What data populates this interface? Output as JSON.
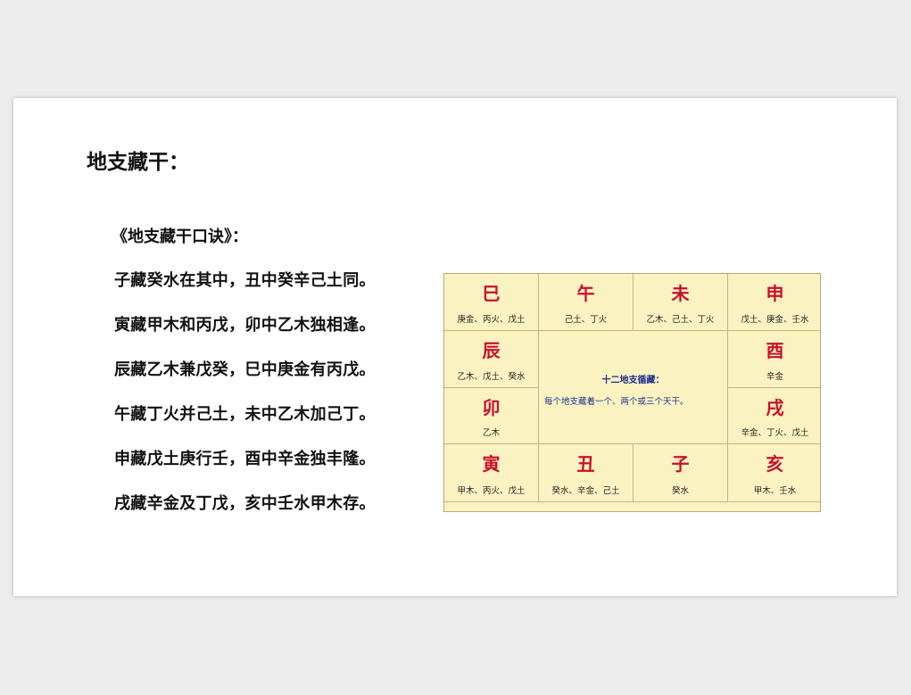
{
  "slide": {
    "heading": "地支藏干：",
    "poem_title": "《地支藏干口诀》：",
    "poem_lines": [
      "子藏癸水在其中，丑中癸辛己土同。",
      "寅藏甲木和丙戊，卯中乙木独相逢。",
      "辰藏乙木兼戊癸，巳中庚金有丙戊。",
      "午藏丁火并己土，未中乙木加己丁。",
      "申藏戊土庚行壬，酉中辛金独丰隆。",
      "戌藏辛金及丁戊，亥中壬水甲木存。"
    ]
  },
  "chart": {
    "center_title": "十二地支循藏：",
    "center_desc": "每个地支藏着一个、两个或三个天干。",
    "cells": [
      {
        "branch": "巳",
        "stems": "庚金、丙火、戊土"
      },
      {
        "branch": "午",
        "stems": "己土、丁火"
      },
      {
        "branch": "未",
        "stems": "乙木、己土、丁火"
      },
      {
        "branch": "申",
        "stems": "戊土、庚金、壬水"
      },
      {
        "branch": "辰",
        "stems": "乙木、戊土、癸水"
      },
      {
        "branch": "酉",
        "stems": "辛金"
      },
      {
        "branch": "卯",
        "stems": "乙木"
      },
      {
        "branch": "戌",
        "stems": "辛金、丁火、戊土"
      },
      {
        "branch": "寅",
        "stems": "甲木、丙火、戊土"
      },
      {
        "branch": "丑",
        "stems": "癸水、辛金、己土"
      },
      {
        "branch": "子",
        "stems": "癸水"
      },
      {
        "branch": "亥",
        "stems": "甲木、壬水"
      }
    ]
  }
}
